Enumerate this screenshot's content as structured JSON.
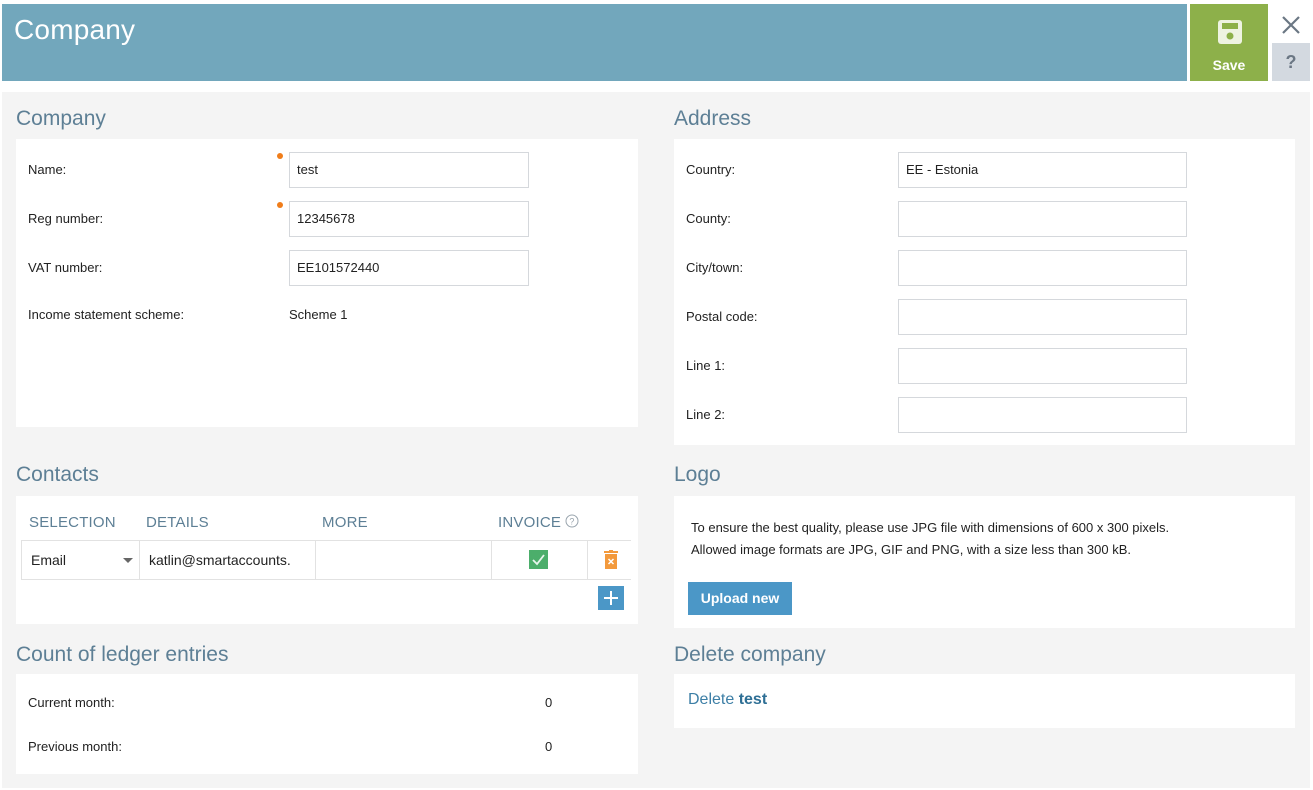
{
  "header": {
    "title": "Company",
    "save_label": "Save",
    "help_label": "?",
    "colors": {
      "header_bg": "#72a7bc",
      "save_bg": "#8db04a",
      "help_bg": "#d3d9e0"
    }
  },
  "company": {
    "title": "Company",
    "fields": [
      {
        "label": "Name:",
        "value": "test",
        "required": true
      },
      {
        "label": "Reg number:",
        "value": "12345678",
        "required": true
      },
      {
        "label": "VAT number:",
        "value": "EE101572440",
        "required": false
      }
    ],
    "scheme_label": "Income statement scheme:",
    "scheme_value": "Scheme 1"
  },
  "address": {
    "title": "Address",
    "fields": [
      {
        "label": "Country:",
        "value": "EE - Estonia"
      },
      {
        "label": "County:",
        "value": ""
      },
      {
        "label": "City/town:",
        "value": ""
      },
      {
        "label": "Postal code:",
        "value": ""
      },
      {
        "label": "Line 1:",
        "value": ""
      },
      {
        "label": "Line 2:",
        "value": ""
      }
    ]
  },
  "contacts": {
    "title": "Contacts",
    "columns": [
      "SELECTION",
      "DETAILS",
      "MORE",
      "INVOICE"
    ],
    "rows": [
      {
        "selection": "Email",
        "details": "katlin@smartaccounts.",
        "more": "",
        "invoice": true
      }
    ]
  },
  "logo": {
    "title": "Logo",
    "line1": "To ensure the best quality, please use JPG file with dimensions of 600 x 300 pixels.",
    "line2": "Allowed image formats are JPG, GIF and PNG, with a size less than 300 kB.",
    "upload_label": "Upload new"
  },
  "ledger": {
    "title": "Count of ledger entries",
    "current_label": "Current month:",
    "current_value": "0",
    "previous_label": "Previous month:",
    "previous_value": "0"
  },
  "delete": {
    "title": "Delete company",
    "prefix": "Delete",
    "name": "test"
  }
}
